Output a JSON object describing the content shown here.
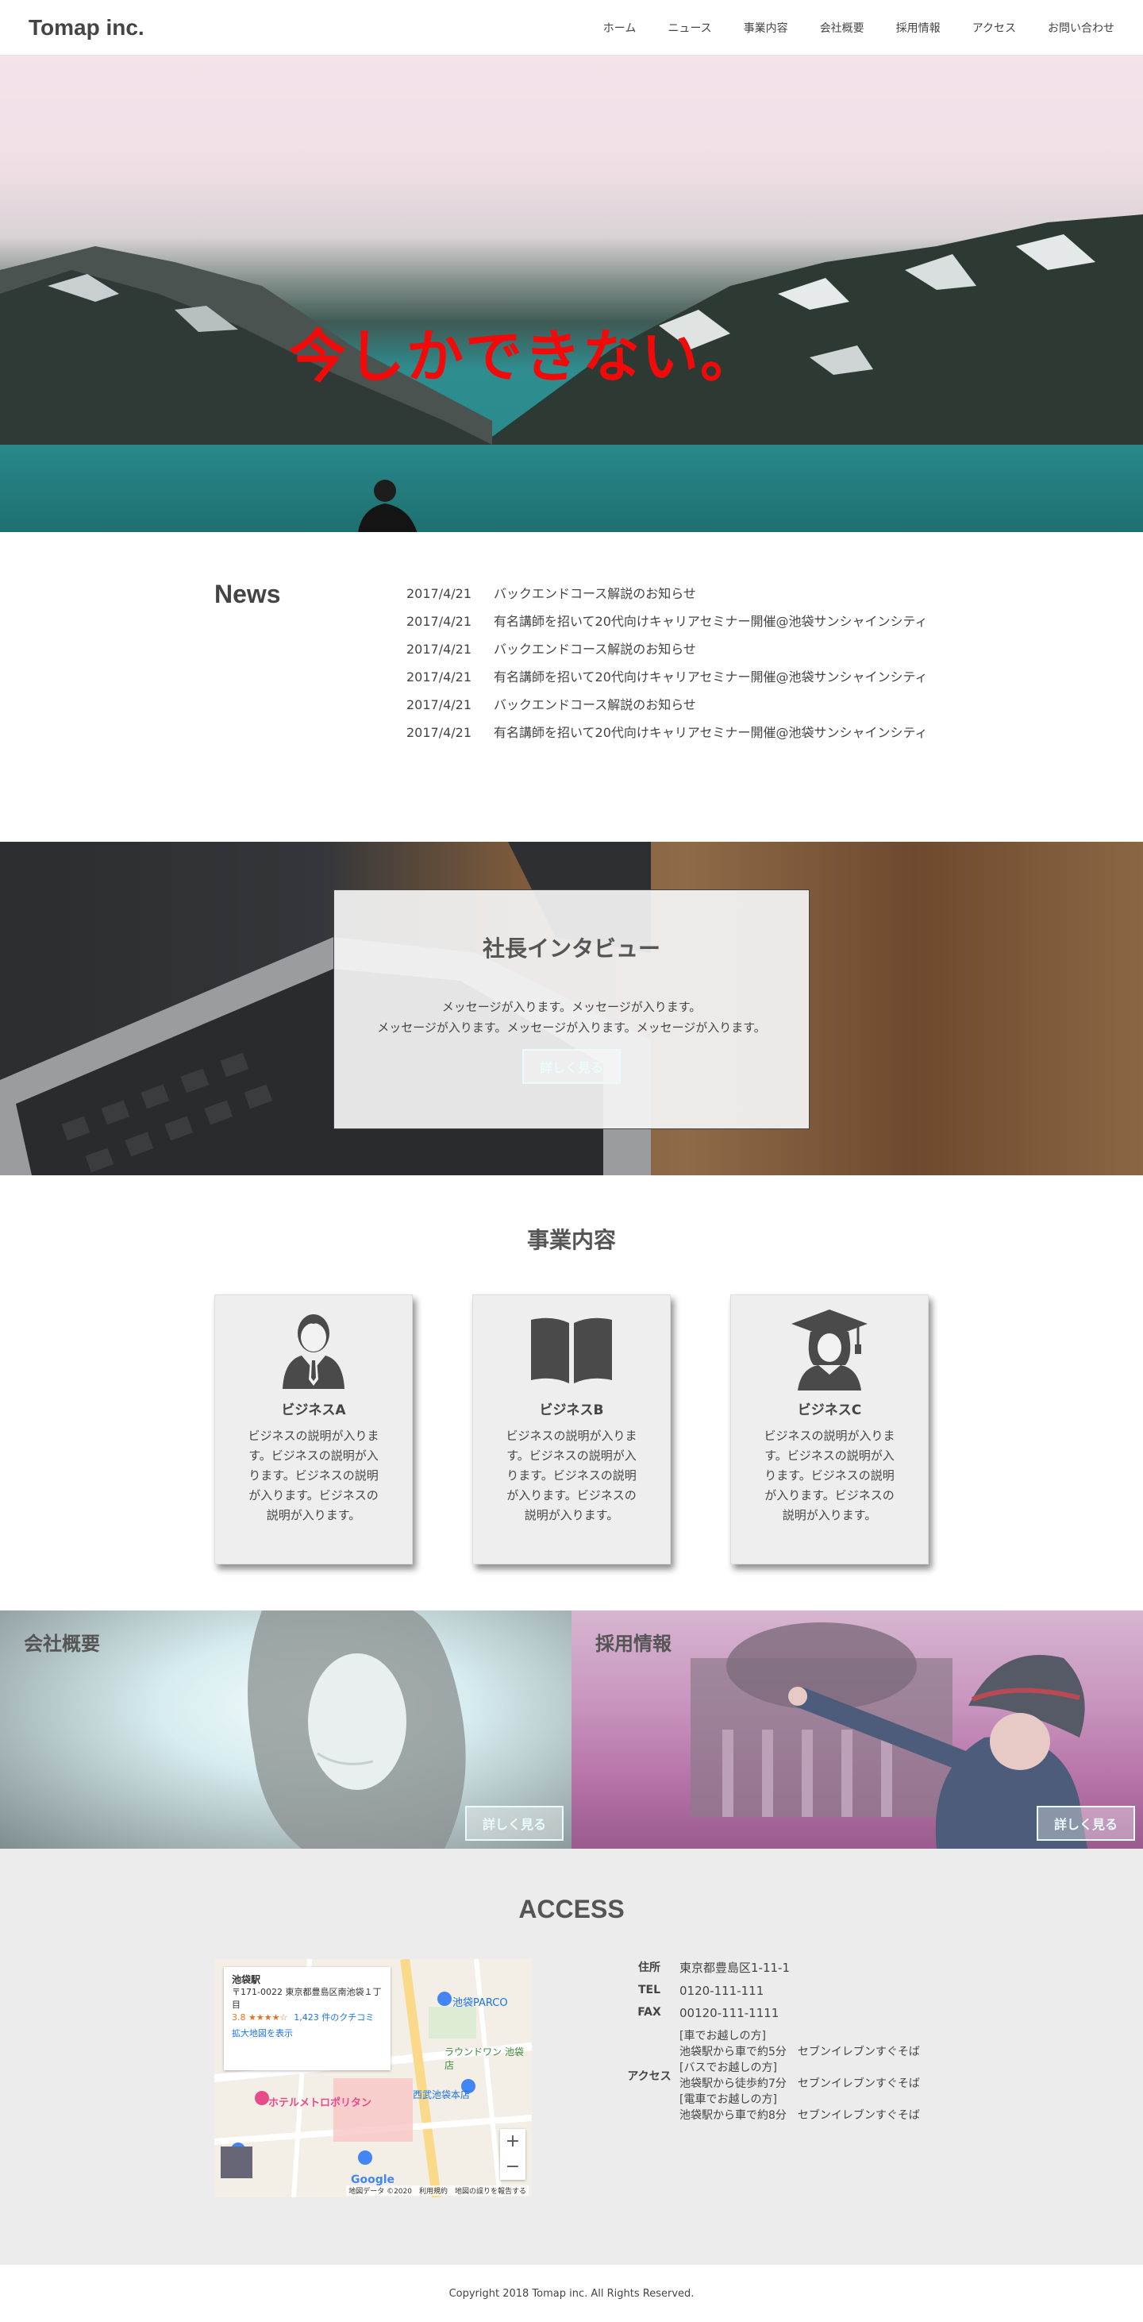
{
  "header": {
    "logo": "Tomap inc.",
    "nav": [
      "ホーム",
      "ニュース",
      "事業内容",
      "会社概要",
      "採用情報",
      "アクセス",
      "お問い合わせ"
    ]
  },
  "hero": {
    "title": "今しかできない。"
  },
  "news": {
    "heading": "News",
    "items": [
      {
        "date": "2017/4/21",
        "text": "バックエンドコース解説のお知らせ"
      },
      {
        "date": "2017/4/21",
        "text": "有名講師を招いて20代向けキャリアセミナー開催@池袋サンシャインシティ"
      },
      {
        "date": "2017/4/21",
        "text": "バックエンドコース解説のお知らせ"
      },
      {
        "date": "2017/4/21",
        "text": "有名講師を招いて20代向けキャリアセミナー開催@池袋サンシャインシティ"
      },
      {
        "date": "2017/4/21",
        "text": "バックエンドコース解説のお知らせ"
      },
      {
        "date": "2017/4/21",
        "text": "有名講師を招いて20代向けキャリアセミナー開催@池袋サンシャインシティ"
      }
    ]
  },
  "interview": {
    "title": "社長インタビュー",
    "line1": "メッセージが入ります。メッセージが入ります。",
    "line2": "メッセージが入ります。メッセージが入ります。メッセージが入ります。",
    "button": "詳しく見る"
  },
  "business": {
    "heading": "事業内容",
    "cards": [
      {
        "icon": "businessman-icon",
        "title": "ビジネスA",
        "text": "ビジネスの説明が入ります。ビジネスの説明が入ります。ビジネスの説明が入ります。ビジネスの説明が入ります。"
      },
      {
        "icon": "book-icon",
        "title": "ビジネスB",
        "text": "ビジネスの説明が入ります。ビジネスの説明が入ります。ビジネスの説明が入ります。ビジネスの説明が入ります。"
      },
      {
        "icon": "graduate-icon",
        "title": "ビジネスC",
        "text": "ビジネスの説明が入ります。ビジネスの説明が入ります。ビジネスの説明が入ります。ビジネスの説明が入ります。"
      }
    ]
  },
  "panels": {
    "company": {
      "title": "会社概要",
      "button": "詳しく見る"
    },
    "recruit": {
      "title": "採用情報",
      "button": "詳しく見る"
    }
  },
  "access": {
    "heading": "ACCESS",
    "map": {
      "place": "池袋駅",
      "address": "〒171-0022 東京都豊島区南池袋１丁目",
      "rating": "3.8 ★★★★☆",
      "reviews": "1,423 件のクチコミ",
      "link": "拡大地図を表示",
      "labels": [
        "池袋PARCO",
        "ラウンドワン 池袋店",
        "西武池袋本店",
        "ホテルメトロポリタン"
      ],
      "footer": "地図データ ©2020　利用規約　地図の誤りを報告する",
      "google": "Google",
      "zoom_in": "+",
      "zoom_out": "−"
    },
    "address_label": "住所",
    "address": "東京都豊島区1-11-1",
    "tel_label": "TEL",
    "tel": "0120-111-111",
    "fax_label": "FAX",
    "fax": "00120-111-1111",
    "access_label": "アクセス",
    "routes": [
      "[車でお越しの方]",
      "池袋駅から車で約5分　セブンイレブンすぐそば",
      "[バスでお越しの方]",
      "池袋駅から徒歩約7分　セブンイレブンすぐそば",
      "[電車でお越しの方]",
      "池袋駅から車で約8分　セブンイレブンすぐそば"
    ]
  },
  "footer": {
    "copyright": "Copyright 2018 Tomap inc. All Rights Reserved."
  }
}
